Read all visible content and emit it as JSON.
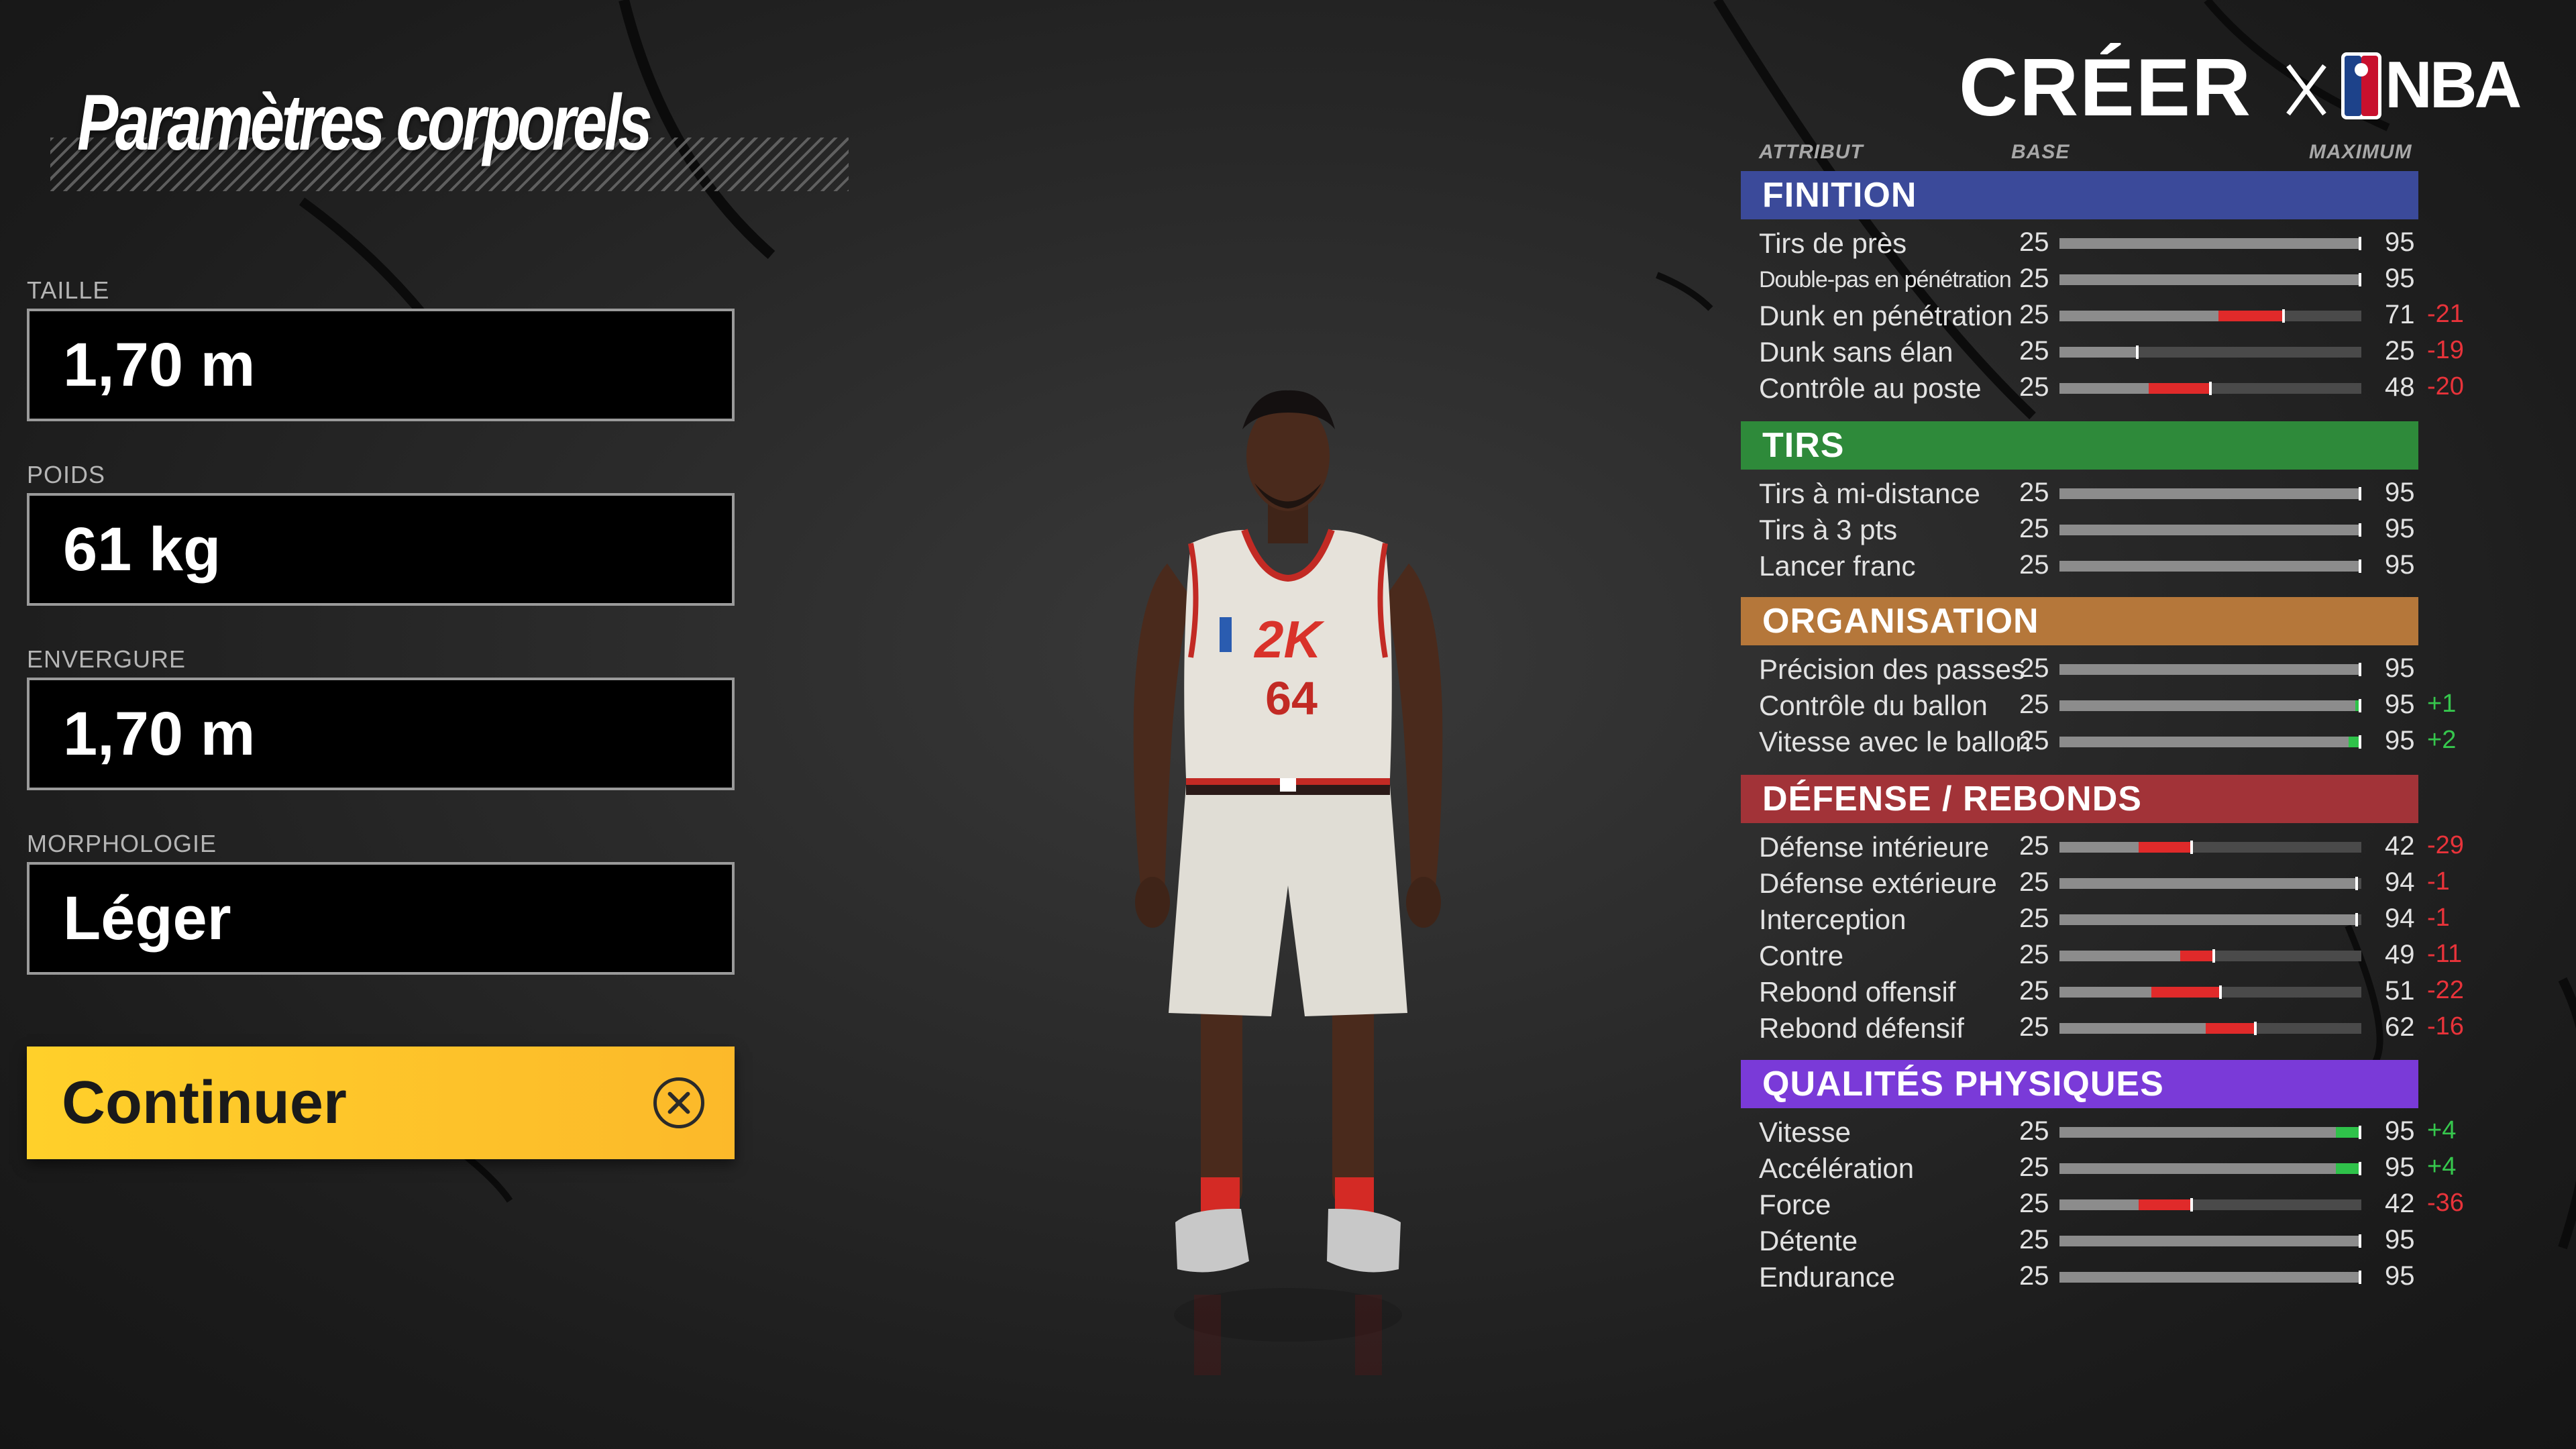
{
  "left_panel": {
    "title": "Paramètres corporels",
    "fields": [
      {
        "label": "TAILLE",
        "value": "1,70 m"
      },
      {
        "label": "POIDS",
        "value": "61 kg"
      },
      {
        "label": "ENVERGURE",
        "value": "1,70 m"
      },
      {
        "label": "MORPHOLOGIE",
        "value": "Léger"
      }
    ],
    "continue_label": "Continuer",
    "continue_icon": "cross-button-icon"
  },
  "player": {
    "jersey_logo": "2K",
    "jersey_number": "64"
  },
  "header": {
    "title": "CRÉER",
    "partner": "NBA"
  },
  "columns": {
    "attribute": "ATTRIBUT",
    "base": "BASE",
    "maximum": "MAXIMUM"
  },
  "categories": [
    {
      "name": "FINITION",
      "color": "#3b4a9a",
      "attributes": [
        {
          "name": "Tirs de près",
          "base": "25",
          "max": "95",
          "delta": "",
          "narrow": false
        },
        {
          "name": "Double-pas en pénétration",
          "base": "25",
          "max": "95",
          "delta": "",
          "narrow": true
        },
        {
          "name": "Dunk en pénétration",
          "base": "25",
          "max": "71",
          "delta": "-21",
          "narrow": false
        },
        {
          "name": "Dunk sans élan",
          "base": "25",
          "max": "25",
          "delta": "-19",
          "narrow": false
        },
        {
          "name": "Contrôle au poste",
          "base": "25",
          "max": "48",
          "delta": "-20",
          "narrow": false
        }
      ]
    },
    {
      "name": "TIRS",
      "color": "#2e8a3a",
      "attributes": [
        {
          "name": "Tirs à mi-distance",
          "base": "25",
          "max": "95",
          "delta": "",
          "narrow": false
        },
        {
          "name": "Tirs à 3 pts",
          "base": "25",
          "max": "95",
          "delta": "",
          "narrow": false
        },
        {
          "name": "Lancer franc",
          "base": "25",
          "max": "95",
          "delta": "",
          "narrow": false
        }
      ]
    },
    {
      "name": "ORGANISATION",
      "color": "#b5773a",
      "attributes": [
        {
          "name": "Précision des passes",
          "base": "25",
          "max": "95",
          "delta": "",
          "narrow": false
        },
        {
          "name": "Contrôle du ballon",
          "base": "25",
          "max": "95",
          "delta": "+1",
          "narrow": false
        },
        {
          "name": "Vitesse avec le ballon",
          "base": "25",
          "max": "95",
          "delta": "+2",
          "narrow": false
        }
      ]
    },
    {
      "name": "DÉFENSE / REBONDS",
      "color": "#a23338",
      "attributes": [
        {
          "name": "Défense intérieure",
          "base": "25",
          "max": "42",
          "delta": "-29",
          "narrow": false
        },
        {
          "name": "Défense extérieure",
          "base": "25",
          "max": "94",
          "delta": "-1",
          "narrow": false
        },
        {
          "name": "Interception",
          "base": "25",
          "max": "94",
          "delta": "-1",
          "narrow": false
        },
        {
          "name": "Contre",
          "base": "25",
          "max": "49",
          "delta": "-11",
          "narrow": false
        },
        {
          "name": "Rebond offensif",
          "base": "25",
          "max": "51",
          "delta": "-22",
          "narrow": false
        },
        {
          "name": "Rebond défensif",
          "base": "25",
          "max": "62",
          "delta": "-16",
          "narrow": false
        }
      ]
    },
    {
      "name": "QUALITÉS PHYSIQUES",
      "color": "#7a3ad8",
      "attributes": [
        {
          "name": "Vitesse",
          "base": "25",
          "max": "95",
          "delta": "+4",
          "narrow": false
        },
        {
          "name": "Accélération",
          "base": "25",
          "max": "95",
          "delta": "+4",
          "narrow": false
        },
        {
          "name": "Force",
          "base": "25",
          "max": "42",
          "delta": "-36",
          "narrow": false
        },
        {
          "name": "Détente",
          "base": "25",
          "max": "95",
          "delta": "",
          "narrow": false
        },
        {
          "name": "Endurance",
          "base": "25",
          "max": "95",
          "delta": "",
          "narrow": false
        }
      ]
    }
  ]
}
